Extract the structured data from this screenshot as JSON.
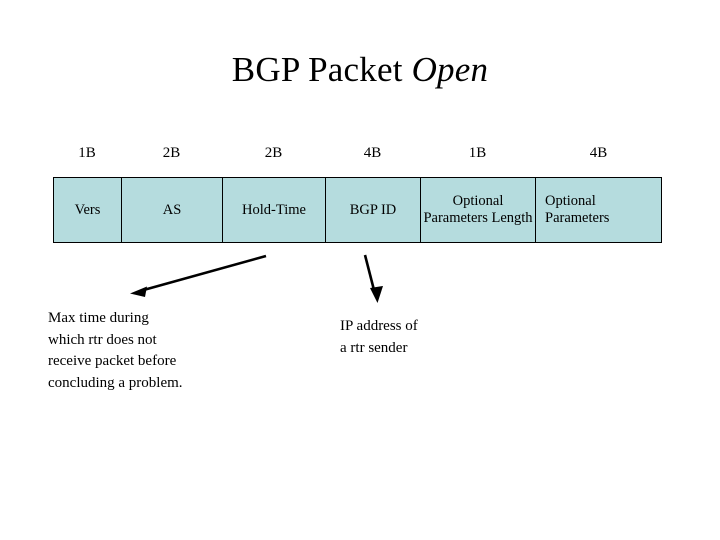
{
  "slide": {
    "title": {
      "main": "BGP Packet ",
      "emphasis": "Open"
    },
    "background_color": "#ffffff",
    "cell_fill_color": "#b5dcde",
    "border_color": "#000000",
    "text_color": "#000000"
  },
  "packet": {
    "size_labels": [
      "1B",
      "2B",
      "2B",
      "4B",
      "1B",
      "4B"
    ],
    "fields": [
      {
        "name": "Vers",
        "size": "1B",
        "align": "center"
      },
      {
        "name": "AS",
        "size": "2B",
        "align": "center"
      },
      {
        "name": "Hold-Time",
        "size": "2B",
        "align": "center"
      },
      {
        "name": "BGP ID",
        "size": "4B",
        "align": "center"
      },
      {
        "name": "Optional Parameters Length",
        "size": "1B",
        "align": "center"
      },
      {
        "name": "Optional Parameters",
        "size": "4B",
        "align": "left"
      }
    ]
  },
  "annotations": [
    {
      "id": "hold-time",
      "text": "Max time during\nwhich rtr does not\nreceive packet before\nconcluding a problem.",
      "points_to": "Hold-Time"
    },
    {
      "id": "bgp-id",
      "text": "IP address of\na rtr sender",
      "points_to": "BGP ID"
    }
  ]
}
